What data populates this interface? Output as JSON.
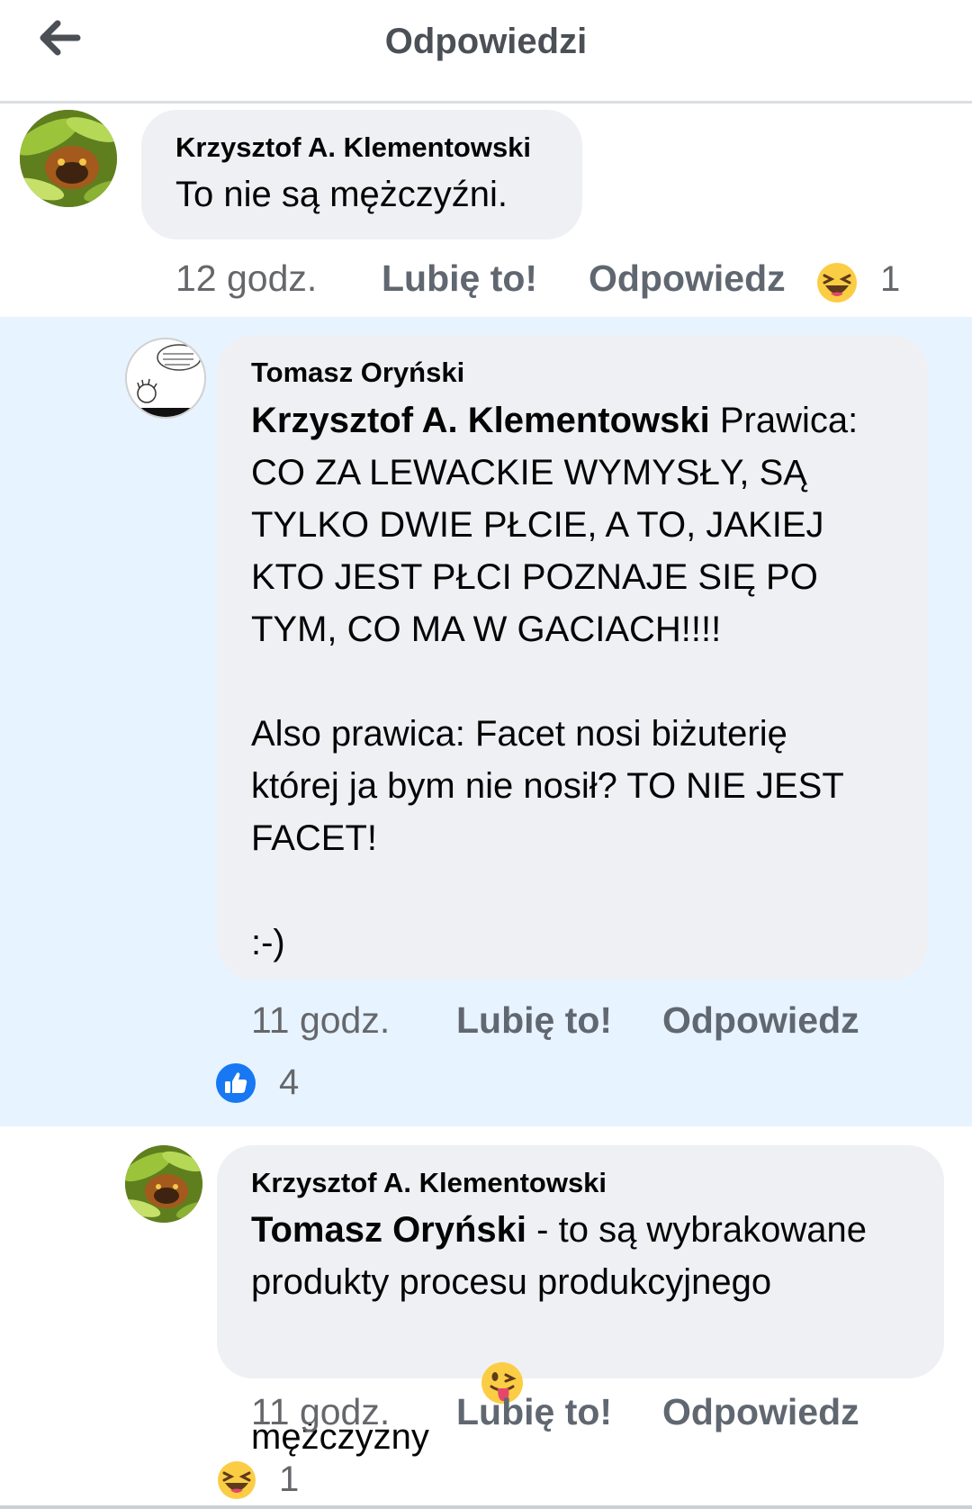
{
  "header": {
    "title": "Odpowiedzi"
  },
  "comments": [
    {
      "author": "Krzysztof A. Klementowski",
      "text": "To nie są mężczyźni.",
      "time": "12 godz.",
      "like_label": "Lubię to!",
      "reply_label": "Odpowiedz",
      "reaction": {
        "icon": "haha-emoji-icon",
        "count": "1"
      }
    },
    {
      "author": "Tomasz Oryński",
      "mention": "Krzysztof A. Klementowski",
      "text_line1_rest": " Prawica:",
      "text_rest": "CO ZA LEWACKIE WYMYSŁY, SĄ\nTYLKO DWIE PŁCIE, A TO, JAKIEJ\nKTO JEST PŁCI POZNAJE SIĘ PO\nTYM, CO MA W GACIACH!!!!\n\nAlso prawica: Facet nosi biżuterię\nktórej ja bym nie nosił? TO NIE JEST\nFACET!\n\n:-)",
      "time": "11 godz.",
      "like_label": "Lubię to!",
      "reply_label": "Odpowiedz",
      "reaction": {
        "icon": "like-thumb-icon",
        "count": "4"
      }
    },
    {
      "author": "Krzysztof A. Klementowski",
      "mention": "Tomasz Oryński",
      "text_line1_rest": " - to są wybrakowane",
      "text_rest": "produkty procesu produkcyjnego\nmężczyzny",
      "emoji": "winking-tongue-emoji-icon",
      "time": "11 godz.",
      "like_label": "Lubię to!",
      "reply_label": "Odpowiedz",
      "reaction": {
        "icon": "haha-emoji-icon",
        "count": "1"
      }
    }
  ],
  "colors": {
    "highlight_bg": "#e7f3ff",
    "bubble_bg": "#eff0f3",
    "meta_gray": "#65676b",
    "like_blue": "#1877f2",
    "emoji_yellow": "#fbcd45"
  }
}
